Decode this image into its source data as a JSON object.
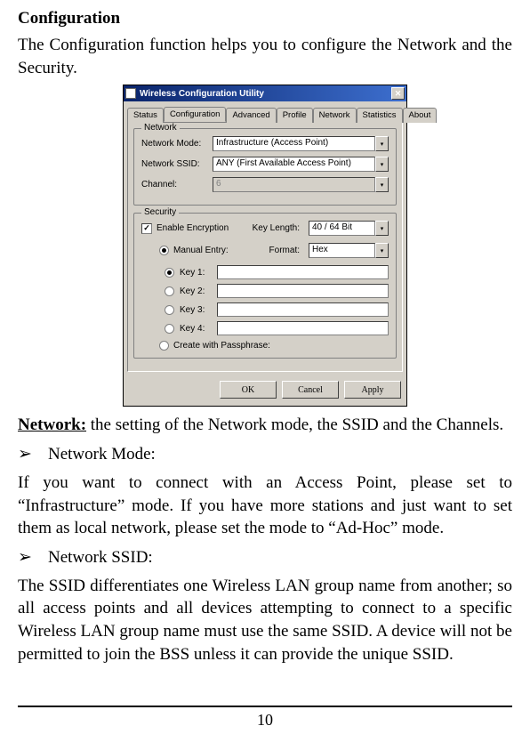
{
  "doc": {
    "heading": "Configuration",
    "intro": "The Configuration function helps you to configure the Network and the Security.",
    "network_heading_bold": "Network:",
    "network_heading_rest": " the setting of the Network mode, the SSID and the Channels.",
    "bullet1": "Network Mode:",
    "bullet1_body": "If you want to connect with an Access Point, please set to “Infrastructure” mode. If you have more stations and just want to set them as local network, please set the mode to “Ad-Hoc” mode.",
    "bullet2": "Network SSID:",
    "bullet2_body": "The SSID differentiates one Wireless LAN group name from another; so all access points and all devices attempting to connect to a specific Wireless LAN group name must use the same SSID. A device will not be permitted to join the BSS unless it can provide the unique SSID.",
    "page_number": "10",
    "arrow": "➢"
  },
  "dialog": {
    "title": "Wireless Configuration Utility",
    "tabs": [
      "Status",
      "Configuration",
      "Advanced",
      "Profile",
      "Network",
      "Statistics",
      "About"
    ],
    "network": {
      "legend": "Network",
      "mode_label": "Network Mode:",
      "mode_value": "Infrastructure (Access Point)",
      "ssid_label": "Network SSID:",
      "ssid_value": "ANY (First Available Access Point)",
      "channel_label": "Channel:",
      "channel_value": "6"
    },
    "security": {
      "legend": "Security",
      "enable": "Enable Encryption",
      "check_mark": "✓",
      "keylen_label": "Key Length:",
      "keylen_value": "40 / 64 Bit",
      "manual": "Manual Entry:",
      "format_label": "Format:",
      "format_value": "Hex",
      "key1": "Key 1:",
      "key2": "Key 2:",
      "key3": "Key 3:",
      "key4": "Key 4:",
      "passphrase": "Create with Passphrase:"
    },
    "buttons": {
      "ok": "OK",
      "cancel": "Cancel",
      "apply": "Apply"
    },
    "dropdown_arrow": "▾",
    "close_x": "✕"
  }
}
